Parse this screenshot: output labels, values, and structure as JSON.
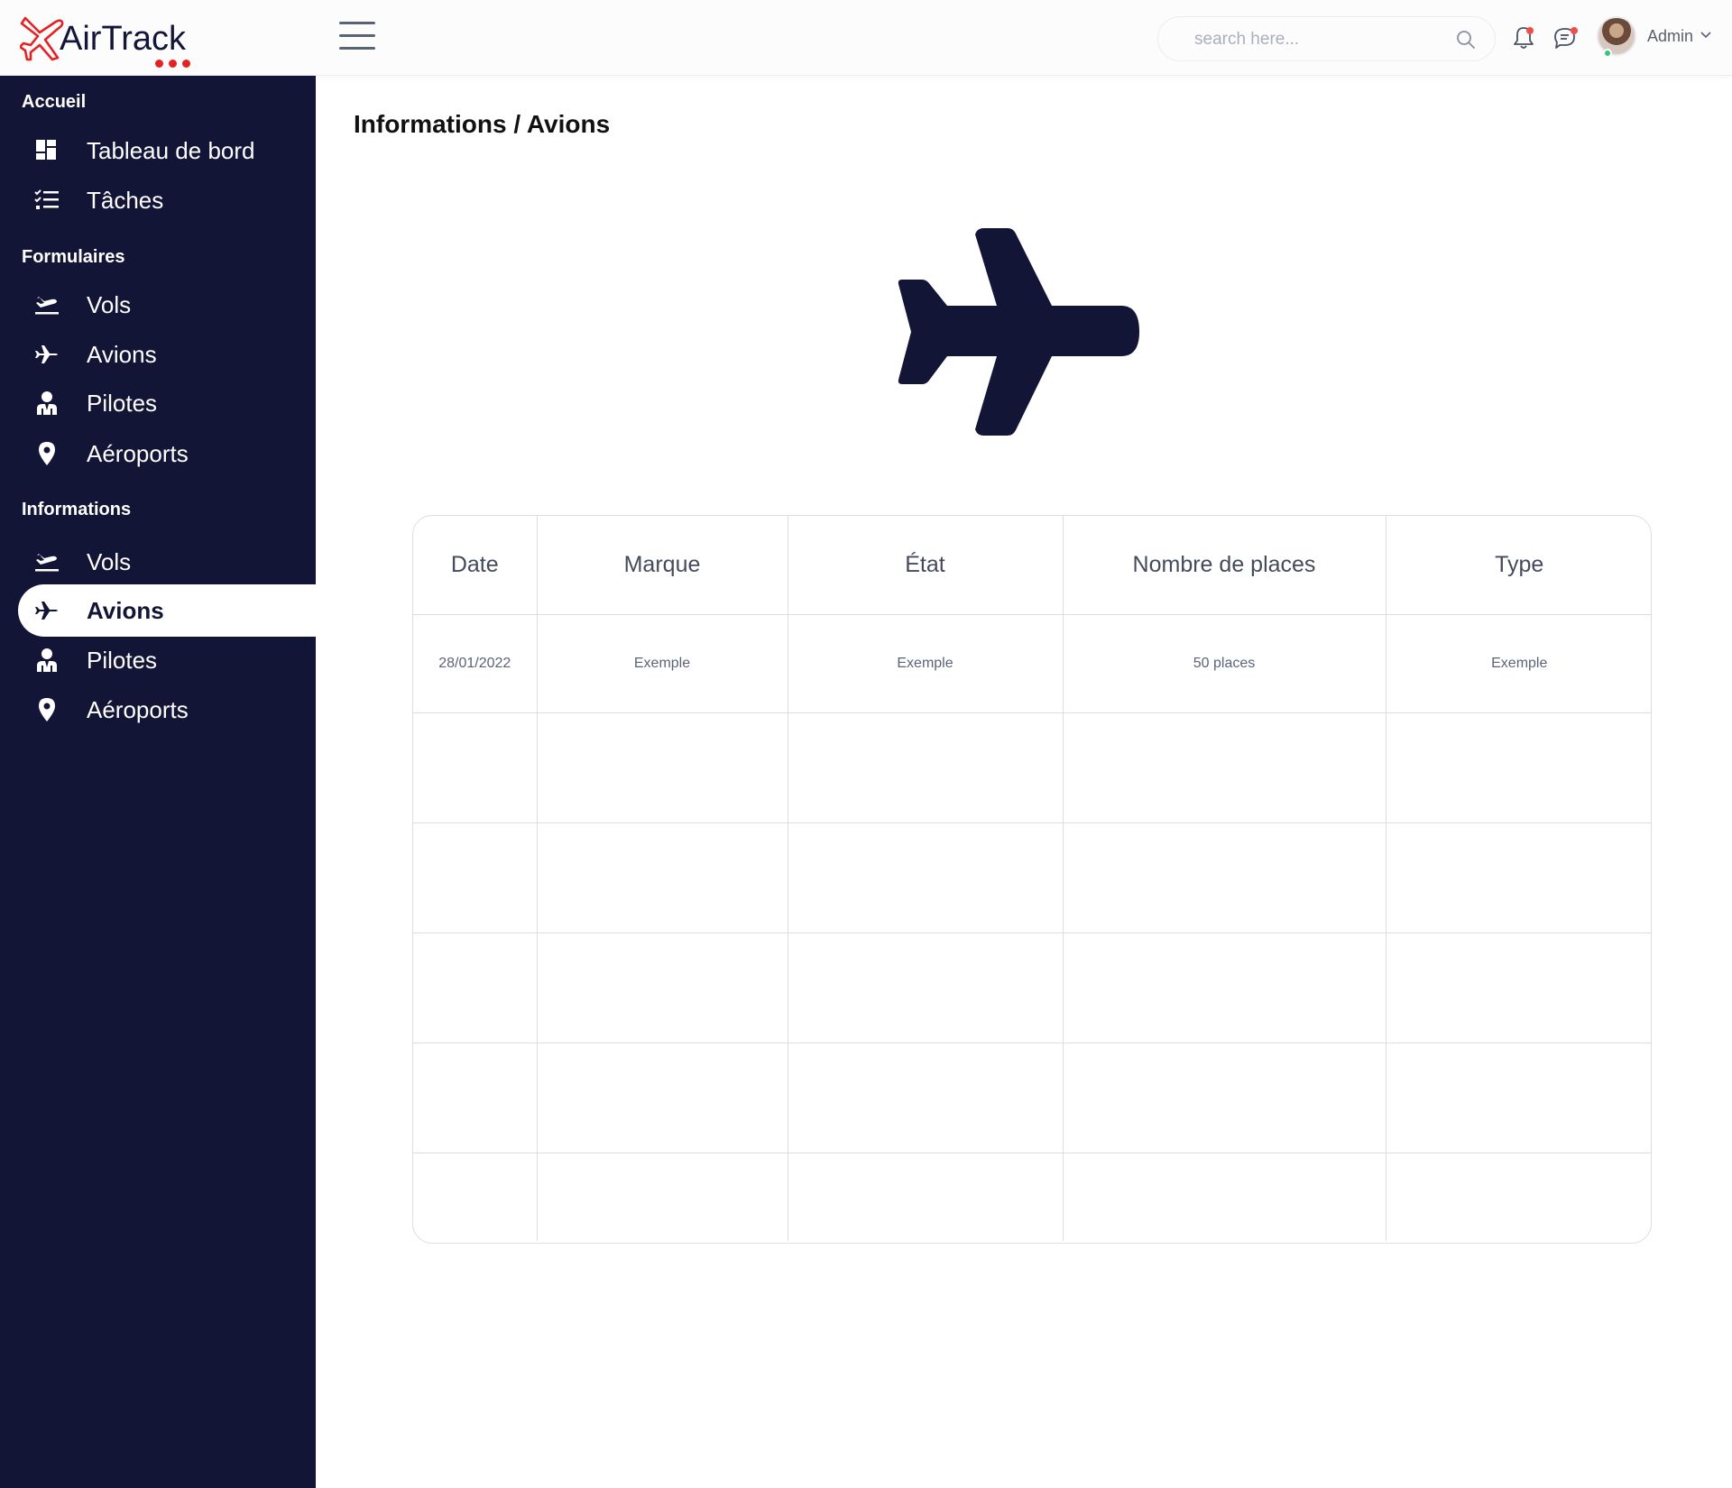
{
  "app": {
    "logo_text": "AirTrack"
  },
  "header": {
    "search_placeholder": "search here...",
    "user_name": "Admin"
  },
  "sidebar": {
    "sections": [
      {
        "title": "Accueil",
        "items": [
          {
            "label": "Tableau de bord",
            "icon": "dashboard-icon"
          },
          {
            "label": "Tâches",
            "icon": "tasks-icon"
          }
        ]
      },
      {
        "title": "Formulaires",
        "items": [
          {
            "label": "Vols",
            "icon": "flight-takeoff-icon"
          },
          {
            "label": "Avions",
            "icon": "airplane-icon"
          },
          {
            "label": "Pilotes",
            "icon": "pilot-icon"
          },
          {
            "label": "Aéroports",
            "icon": "location-pin-icon"
          }
        ]
      },
      {
        "title": "Informations",
        "items": [
          {
            "label": "Vols",
            "icon": "flight-takeoff-icon"
          },
          {
            "label": "Avions",
            "icon": "airplane-icon",
            "active": true
          },
          {
            "label": "Pilotes",
            "icon": "pilot-icon"
          },
          {
            "label": "Aéroports",
            "icon": "location-pin-icon"
          }
        ]
      }
    ]
  },
  "main": {
    "title": "Informations / Avions",
    "table": {
      "columns": [
        "Date",
        "Marque",
        "État",
        "Nombre de places",
        "Type"
      ],
      "rows": [
        [
          "28/01/2022",
          "Exemple",
          "Exemple",
          "50 places",
          "Exemple"
        ],
        [
          "",
          "",
          "",
          "",
          ""
        ],
        [
          "",
          "",
          "",
          "",
          ""
        ],
        [
          "",
          "",
          "",
          "",
          ""
        ],
        [
          "",
          "",
          "",
          "",
          ""
        ],
        [
          "",
          "",
          "",
          "",
          ""
        ]
      ]
    }
  },
  "colors": {
    "sidebar_bg": "#121536",
    "accent_red": "#e52222",
    "text_dark": "#111111"
  }
}
